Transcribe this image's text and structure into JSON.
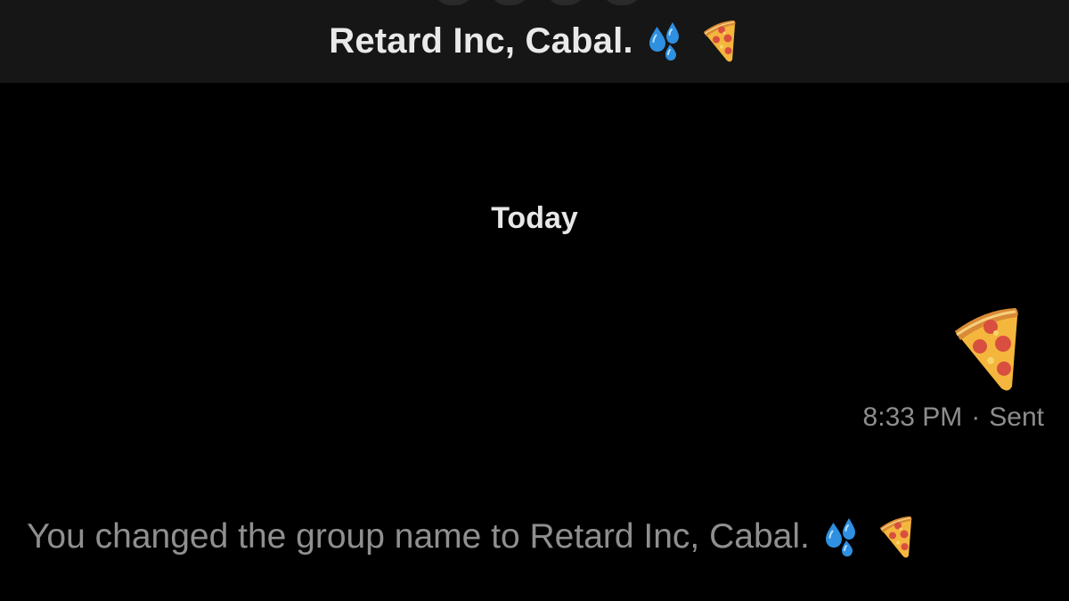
{
  "header": {
    "group_name": "Retard Inc, Cabal.",
    "emojis": [
      "droplets-icon",
      "pizza-icon"
    ]
  },
  "conversation": {
    "date_separator": "Today",
    "sent_message": {
      "emoji": "pizza-icon",
      "time": "8:33 PM",
      "status": "Sent",
      "status_separator": "·"
    },
    "system_notice": {
      "text": "You changed the group name to Retard Inc, Cabal.",
      "emojis": [
        "droplets-icon",
        "pizza-icon"
      ]
    }
  },
  "colors": {
    "background": "#000000",
    "header_background": "#161616",
    "title_text": "#e9e9e9",
    "secondary_text": "#8d8d8d"
  }
}
